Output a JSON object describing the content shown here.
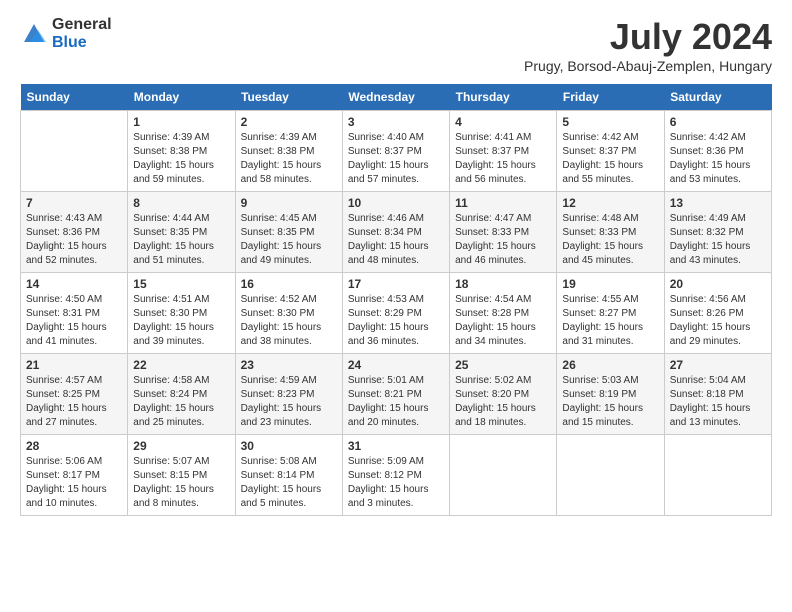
{
  "header": {
    "logo_general": "General",
    "logo_blue": "Blue",
    "month_title": "July 2024",
    "subtitle": "Prugy, Borsod-Abauj-Zemplen, Hungary"
  },
  "days_of_week": [
    "Sunday",
    "Monday",
    "Tuesday",
    "Wednesday",
    "Thursday",
    "Friday",
    "Saturday"
  ],
  "weeks": [
    [
      {
        "day": "",
        "sunrise": "",
        "sunset": "",
        "daylight": ""
      },
      {
        "day": "1",
        "sunrise": "Sunrise: 4:39 AM",
        "sunset": "Sunset: 8:38 PM",
        "daylight": "Daylight: 15 hours and 59 minutes."
      },
      {
        "day": "2",
        "sunrise": "Sunrise: 4:39 AM",
        "sunset": "Sunset: 8:38 PM",
        "daylight": "Daylight: 15 hours and 58 minutes."
      },
      {
        "day": "3",
        "sunrise": "Sunrise: 4:40 AM",
        "sunset": "Sunset: 8:37 PM",
        "daylight": "Daylight: 15 hours and 57 minutes."
      },
      {
        "day": "4",
        "sunrise": "Sunrise: 4:41 AM",
        "sunset": "Sunset: 8:37 PM",
        "daylight": "Daylight: 15 hours and 56 minutes."
      },
      {
        "day": "5",
        "sunrise": "Sunrise: 4:42 AM",
        "sunset": "Sunset: 8:37 PM",
        "daylight": "Daylight: 15 hours and 55 minutes."
      },
      {
        "day": "6",
        "sunrise": "Sunrise: 4:42 AM",
        "sunset": "Sunset: 8:36 PM",
        "daylight": "Daylight: 15 hours and 53 minutes."
      }
    ],
    [
      {
        "day": "7",
        "sunrise": "Sunrise: 4:43 AM",
        "sunset": "Sunset: 8:36 PM",
        "daylight": "Daylight: 15 hours and 52 minutes."
      },
      {
        "day": "8",
        "sunrise": "Sunrise: 4:44 AM",
        "sunset": "Sunset: 8:35 PM",
        "daylight": "Daylight: 15 hours and 51 minutes."
      },
      {
        "day": "9",
        "sunrise": "Sunrise: 4:45 AM",
        "sunset": "Sunset: 8:35 PM",
        "daylight": "Daylight: 15 hours and 49 minutes."
      },
      {
        "day": "10",
        "sunrise": "Sunrise: 4:46 AM",
        "sunset": "Sunset: 8:34 PM",
        "daylight": "Daylight: 15 hours and 48 minutes."
      },
      {
        "day": "11",
        "sunrise": "Sunrise: 4:47 AM",
        "sunset": "Sunset: 8:33 PM",
        "daylight": "Daylight: 15 hours and 46 minutes."
      },
      {
        "day": "12",
        "sunrise": "Sunrise: 4:48 AM",
        "sunset": "Sunset: 8:33 PM",
        "daylight": "Daylight: 15 hours and 45 minutes."
      },
      {
        "day": "13",
        "sunrise": "Sunrise: 4:49 AM",
        "sunset": "Sunset: 8:32 PM",
        "daylight": "Daylight: 15 hours and 43 minutes."
      }
    ],
    [
      {
        "day": "14",
        "sunrise": "Sunrise: 4:50 AM",
        "sunset": "Sunset: 8:31 PM",
        "daylight": "Daylight: 15 hours and 41 minutes."
      },
      {
        "day": "15",
        "sunrise": "Sunrise: 4:51 AM",
        "sunset": "Sunset: 8:30 PM",
        "daylight": "Daylight: 15 hours and 39 minutes."
      },
      {
        "day": "16",
        "sunrise": "Sunrise: 4:52 AM",
        "sunset": "Sunset: 8:30 PM",
        "daylight": "Daylight: 15 hours and 38 minutes."
      },
      {
        "day": "17",
        "sunrise": "Sunrise: 4:53 AM",
        "sunset": "Sunset: 8:29 PM",
        "daylight": "Daylight: 15 hours and 36 minutes."
      },
      {
        "day": "18",
        "sunrise": "Sunrise: 4:54 AM",
        "sunset": "Sunset: 8:28 PM",
        "daylight": "Daylight: 15 hours and 34 minutes."
      },
      {
        "day": "19",
        "sunrise": "Sunrise: 4:55 AM",
        "sunset": "Sunset: 8:27 PM",
        "daylight": "Daylight: 15 hours and 31 minutes."
      },
      {
        "day": "20",
        "sunrise": "Sunrise: 4:56 AM",
        "sunset": "Sunset: 8:26 PM",
        "daylight": "Daylight: 15 hours and 29 minutes."
      }
    ],
    [
      {
        "day": "21",
        "sunrise": "Sunrise: 4:57 AM",
        "sunset": "Sunset: 8:25 PM",
        "daylight": "Daylight: 15 hours and 27 minutes."
      },
      {
        "day": "22",
        "sunrise": "Sunrise: 4:58 AM",
        "sunset": "Sunset: 8:24 PM",
        "daylight": "Daylight: 15 hours and 25 minutes."
      },
      {
        "day": "23",
        "sunrise": "Sunrise: 4:59 AM",
        "sunset": "Sunset: 8:23 PM",
        "daylight": "Daylight: 15 hours and 23 minutes."
      },
      {
        "day": "24",
        "sunrise": "Sunrise: 5:01 AM",
        "sunset": "Sunset: 8:21 PM",
        "daylight": "Daylight: 15 hours and 20 minutes."
      },
      {
        "day": "25",
        "sunrise": "Sunrise: 5:02 AM",
        "sunset": "Sunset: 8:20 PM",
        "daylight": "Daylight: 15 hours and 18 minutes."
      },
      {
        "day": "26",
        "sunrise": "Sunrise: 5:03 AM",
        "sunset": "Sunset: 8:19 PM",
        "daylight": "Daylight: 15 hours and 15 minutes."
      },
      {
        "day": "27",
        "sunrise": "Sunrise: 5:04 AM",
        "sunset": "Sunset: 8:18 PM",
        "daylight": "Daylight: 15 hours and 13 minutes."
      }
    ],
    [
      {
        "day": "28",
        "sunrise": "Sunrise: 5:06 AM",
        "sunset": "Sunset: 8:17 PM",
        "daylight": "Daylight: 15 hours and 10 minutes."
      },
      {
        "day": "29",
        "sunrise": "Sunrise: 5:07 AM",
        "sunset": "Sunset: 8:15 PM",
        "daylight": "Daylight: 15 hours and 8 minutes."
      },
      {
        "day": "30",
        "sunrise": "Sunrise: 5:08 AM",
        "sunset": "Sunset: 8:14 PM",
        "daylight": "Daylight: 15 hours and 5 minutes."
      },
      {
        "day": "31",
        "sunrise": "Sunrise: 5:09 AM",
        "sunset": "Sunset: 8:12 PM",
        "daylight": "Daylight: 15 hours and 3 minutes."
      },
      {
        "day": "",
        "sunrise": "",
        "sunset": "",
        "daylight": ""
      },
      {
        "day": "",
        "sunrise": "",
        "sunset": "",
        "daylight": ""
      },
      {
        "day": "",
        "sunrise": "",
        "sunset": "",
        "daylight": ""
      }
    ]
  ]
}
